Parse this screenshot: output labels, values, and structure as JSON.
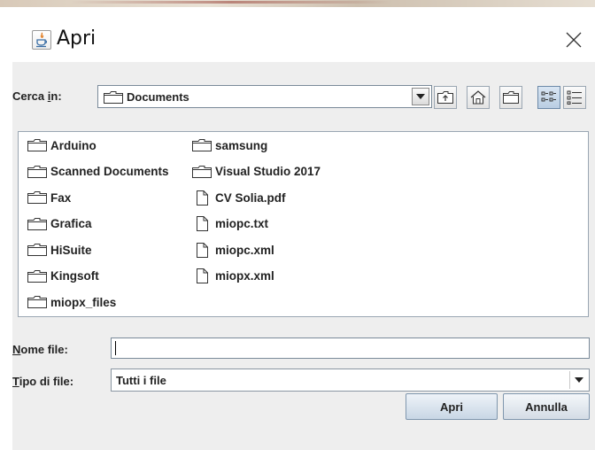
{
  "window": {
    "title": "Apri"
  },
  "toolbar": {
    "lookin_label": "Cerca in:",
    "lookin_prefix": "Cerca ",
    "lookin_mnemonic": "i",
    "lookin_suffix": "n:",
    "current_folder": "Documents",
    "buttons": [
      "up-one-level-icon",
      "home-icon",
      "new-folder-icon",
      "list-view-icon",
      "details-view-icon"
    ],
    "active_view": "list-view-icon"
  },
  "files": {
    "column1": [
      {
        "name": "Arduino",
        "type": "folder"
      },
      {
        "name": "Scanned Documents",
        "type": "folder"
      },
      {
        "name": "Fax",
        "type": "folder"
      },
      {
        "name": "Grafica",
        "type": "folder"
      },
      {
        "name": "HiSuite",
        "type": "folder"
      },
      {
        "name": "Kingsoft",
        "type": "folder"
      },
      {
        "name": "miopx_files",
        "type": "folder"
      }
    ],
    "column2": [
      {
        "name": "samsung",
        "type": "folder"
      },
      {
        "name": "Visual Studio 2017",
        "type": "folder"
      },
      {
        "name": "CV Solia.pdf",
        "type": "file"
      },
      {
        "name": "miopc.txt",
        "type": "file"
      },
      {
        "name": "miopc.xml",
        "type": "file"
      },
      {
        "name": "miopx.xml",
        "type": "file"
      }
    ]
  },
  "filename": {
    "label": "Nome file:",
    "mnemonic": "N",
    "rest": "ome file:",
    "value": ""
  },
  "filetype": {
    "label": "Tipo di file:",
    "mnemonic": "T",
    "rest": "ipo di file:",
    "selected": "Tutti i file"
  },
  "buttons": {
    "open": "Apri",
    "cancel": "Annulla"
  },
  "colors": {
    "dialog_bg": "#eeeeee",
    "border": "#7a8a99",
    "button_top": "#f4f7fa",
    "button_bottom": "#d4dce5"
  }
}
